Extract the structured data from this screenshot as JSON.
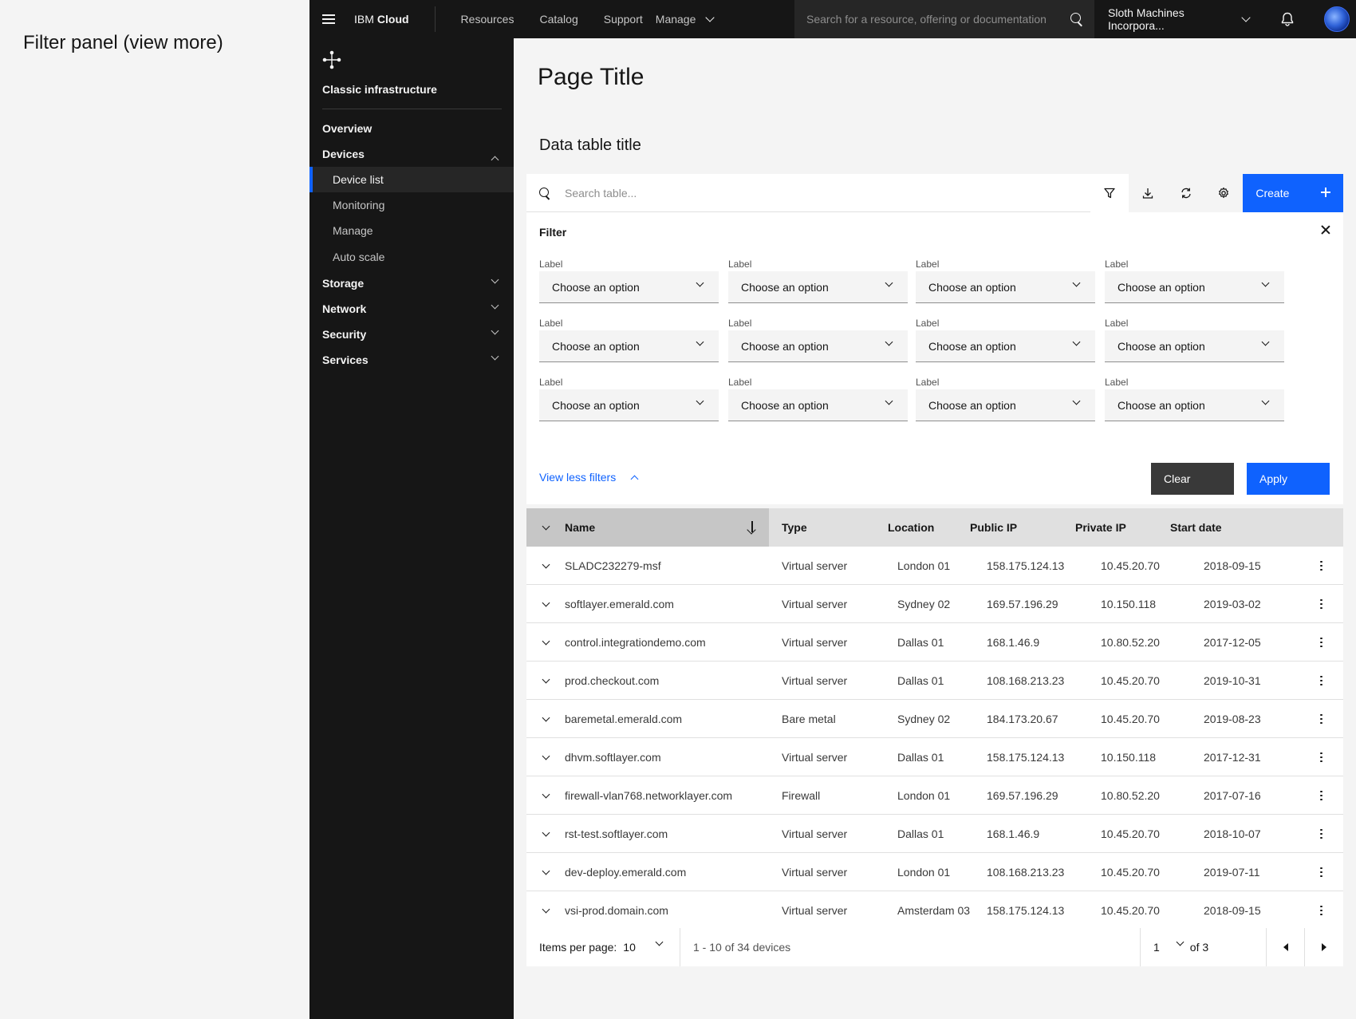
{
  "caption": "Filter panel (view more)",
  "topbar": {
    "brand_prefix": "IBM",
    "brand_name": "Cloud",
    "nav": [
      "Resources",
      "Catalog",
      "Support",
      "Manage"
    ],
    "search_placeholder": "Search for a resource, offering or documentation",
    "account": "Sloth Machines Incorpora...",
    "icons": [
      "menu-icon",
      "chevron-down-icon",
      "search-icon",
      "notification-icon",
      "avatar"
    ]
  },
  "sidebar": {
    "title": "Classic infrastructure",
    "items": [
      {
        "label": "Overview"
      },
      {
        "label": "Devices",
        "expanded": true,
        "children": [
          "Device list",
          "Monitoring",
          "Manage",
          "Auto scale"
        ],
        "active_child": "Device list"
      },
      {
        "label": "Storage"
      },
      {
        "label": "Network"
      },
      {
        "label": "Security"
      },
      {
        "label": "Services"
      }
    ]
  },
  "main": {
    "page_title": "Page Title",
    "table_title": "Data table title",
    "search_placeholder": "Search table...",
    "toolbar_icons": [
      "filter-icon",
      "download-icon",
      "refresh-icon",
      "settings-icon"
    ],
    "create_label": "Create",
    "filter": {
      "title": "Filter",
      "label": "Label",
      "placeholder": "Choose an option",
      "view_less": "View less filters",
      "clear": "Clear",
      "apply": "Apply"
    },
    "columns": [
      "Name",
      "Type",
      "Location",
      "Public IP",
      "Private IP",
      "Start date"
    ],
    "sorted_column": "Name",
    "rows": [
      [
        "SLADC232279-msf",
        "Virtual server",
        "London 01",
        "158.175.124.13",
        "10.45.20.70",
        "2018-09-15"
      ],
      [
        "softlayer.emerald.com",
        "Virtual server",
        "Sydney 02",
        "169.57.196.29",
        "10.150.118",
        "2019-03-02"
      ],
      [
        "control.integrationdemo.com",
        "Virtual server",
        "Dallas 01",
        "168.1.46.9",
        "10.80.52.20",
        "2017-12-05"
      ],
      [
        "prod.checkout.com",
        "Virtual server",
        "Dallas 01",
        "108.168.213.23",
        "10.45.20.70",
        "2019-10-31"
      ],
      [
        "baremetal.emerald.com",
        "Bare metal",
        "Sydney 02",
        "184.173.20.67",
        "10.45.20.70",
        "2019-08-23"
      ],
      [
        "dhvm.softlayer.com",
        "Virtual server",
        "Dallas 01",
        "158.175.124.13",
        "10.150.118",
        "2017-12-31"
      ],
      [
        "firewall-vlan768.networklayer.com",
        "Firewall",
        "London 01",
        "169.57.196.29",
        "10.80.52.20",
        "2017-07-16"
      ],
      [
        "rst-test.softlayer.com",
        "Virtual server",
        "Dallas 01",
        "168.1.46.9",
        "10.45.20.70",
        "2018-10-07"
      ],
      [
        "dev-deploy.emerald.com",
        "Virtual server",
        "London 01",
        "108.168.213.23",
        "10.45.20.70",
        "2019-07-11"
      ],
      [
        "vsi-prod.domain.com",
        "Virtual server",
        "Amsterdam 03",
        "158.175.124.13",
        "10.45.20.70",
        "2018-09-15"
      ]
    ],
    "pagination": {
      "items_per_page_label": "Items per page:",
      "items_per_page": "10",
      "range": "1 - 10 of 34 devices",
      "page": "1",
      "of_pages": "of 3"
    }
  },
  "colors": {
    "brand_blue": "#0f62fe",
    "shell_dark": "#161616",
    "bg": "#f4f4f4"
  }
}
